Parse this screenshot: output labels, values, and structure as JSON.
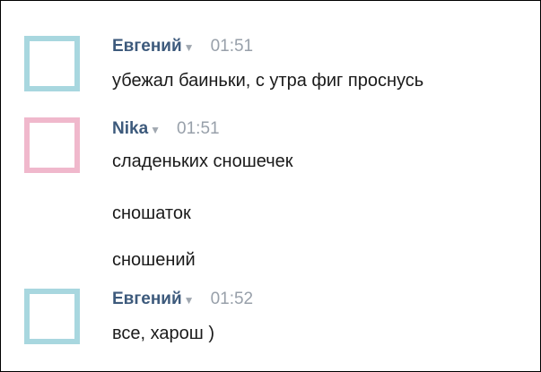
{
  "messages": [
    {
      "author": "Евгений",
      "time": "01:51",
      "avatar_color": "#a8d7df",
      "lines": [
        "убежал баиньки, с утра фиг проснусь"
      ]
    },
    {
      "author": "Nika",
      "time": "01:51",
      "avatar_color": "#f0b8cc",
      "lines": [
        "сладеньких сношечек",
        "сношаток",
        "сношений"
      ]
    },
    {
      "author": "Евгений",
      "time": "01:52",
      "avatar_color": "#a8d7df",
      "lines": [
        "все, харош )"
      ]
    }
  ],
  "icons": {
    "author_menu": "caret-down-icon",
    "caret_glyph": "▼"
  }
}
